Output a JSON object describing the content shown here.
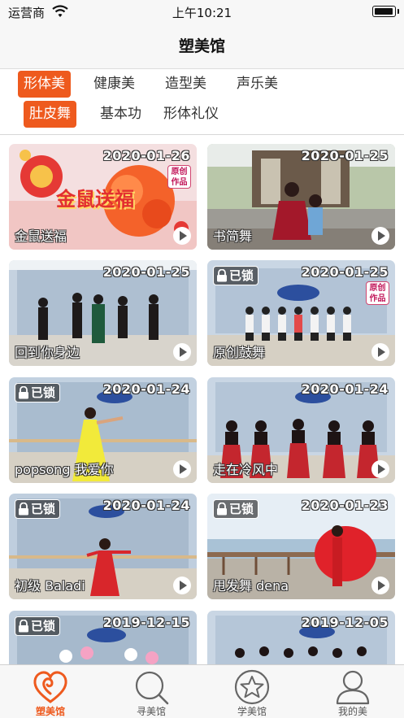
{
  "status_bar": {
    "carrier": "运营商",
    "time": "上午10:21"
  },
  "nav": {
    "title": "塑美馆"
  },
  "categories": {
    "row1": [
      "形体美",
      "健康美",
      "造型美",
      "声乐美"
    ],
    "row2": [
      "肚皮舞",
      "基本功",
      "形体礼仪"
    ],
    "selected_row1": "形体美",
    "selected_row2": "肚皮舞"
  },
  "badges": {
    "locked": "已锁",
    "original_line1": "原创",
    "original_line2": "作品"
  },
  "videos": [
    {
      "title": "金鼠送福",
      "date": "2020-01-26",
      "locked": false,
      "original": true,
      "banner": "金鼠送福"
    },
    {
      "title": "书简舞",
      "date": "2020-01-25",
      "locked": false,
      "original": false
    },
    {
      "title": "回到你身边",
      "date": "2020-01-25",
      "locked": false,
      "original": false
    },
    {
      "title": "原创鼓舞",
      "date": "2020-01-25",
      "locked": true,
      "original": true
    },
    {
      "title": "popsong 我爱你",
      "date": "2020-01-24",
      "locked": true,
      "original": false
    },
    {
      "title": "走在冷风中",
      "date": "2020-01-24",
      "locked": false,
      "original": false
    },
    {
      "title": "初级 Baladi",
      "date": "2020-01-24",
      "locked": true,
      "original": false
    },
    {
      "title": "甩发舞 dena",
      "date": "2020-01-23",
      "locked": true,
      "original": false
    },
    {
      "title": "",
      "date": "2019-12-15",
      "locked": true,
      "original": false
    },
    {
      "title": "",
      "date": "2019-12-05",
      "locked": false,
      "original": false
    }
  ],
  "tab_bar": {
    "tabs": [
      {
        "label": "塑美馆",
        "icon": "heart-swirl-icon",
        "active": true
      },
      {
        "label": "寻美馆",
        "icon": "search-icon",
        "active": false
      },
      {
        "label": "学美馆",
        "icon": "star-circle-icon",
        "active": false
      },
      {
        "label": "我的美",
        "icon": "person-icon",
        "active": false
      }
    ]
  },
  "colors": {
    "accent": "#ee5a1e",
    "bar_background": "#f7f7f7"
  }
}
